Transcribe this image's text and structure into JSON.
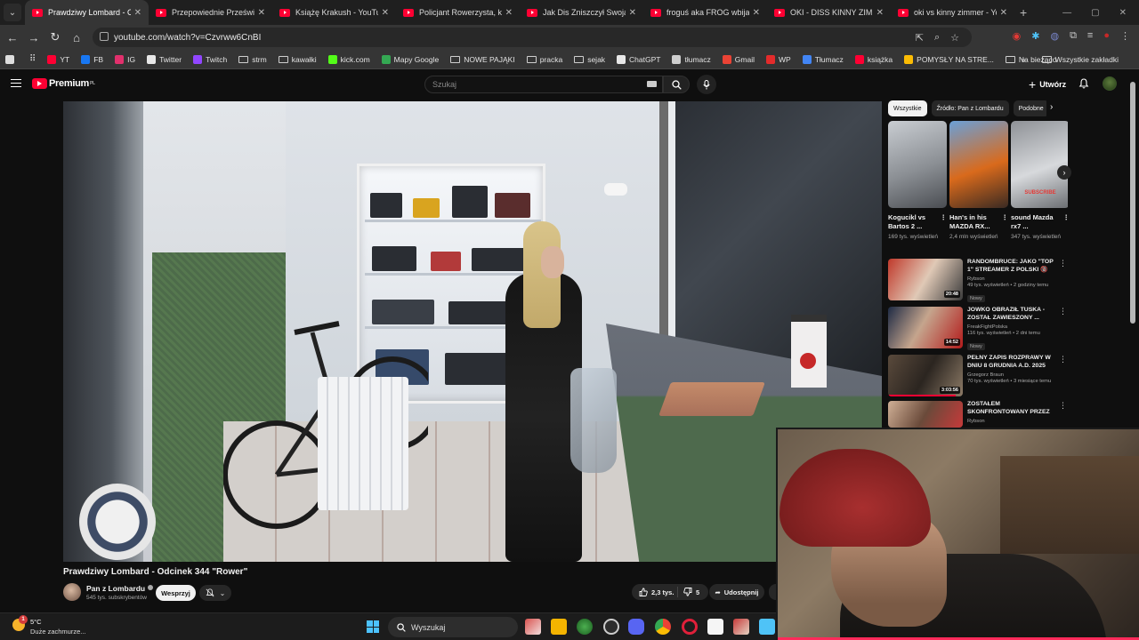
{
  "browser": {
    "tabs": [
      {
        "title": "Prawdziwy Lombard - Od",
        "active": true
      },
      {
        "title": "Przepowiednie Prześwira",
        "active": false
      },
      {
        "title": "Książę Krakush - YouTube",
        "active": false
      },
      {
        "title": "Policjant Rowerzysta, któr",
        "active": false
      },
      {
        "title": "Jak Dis Zniszczył Swoją Ka",
        "active": false
      },
      {
        "title": "froguś aka FROG wbija się",
        "active": false
      },
      {
        "title": "OKI - DISS KINNY ZIMME",
        "active": false
      },
      {
        "title": "oki vs kinny zimmer - You",
        "active": false
      }
    ],
    "url": "youtube.com/watch?v=Czvrww6CnBI",
    "bookmarks": [
      {
        "label": "YT",
        "icon": "youtube-icon",
        "color": "#ff0033"
      },
      {
        "label": "FB",
        "icon": "facebook-icon",
        "color": "#1877f2"
      },
      {
        "label": "IG",
        "icon": "instagram-icon",
        "color": "#e1306c"
      },
      {
        "label": "Twitter",
        "icon": "x-icon",
        "color": "#e8e8e8"
      },
      {
        "label": "Twitch",
        "icon": "twitch-icon",
        "color": "#9146ff"
      },
      {
        "label": "strm",
        "icon": "folder-icon",
        "color": ""
      },
      {
        "label": "kawałki",
        "icon": "folder-icon",
        "color": ""
      },
      {
        "label": "kick.com",
        "icon": "kick-icon",
        "color": "#53fc18"
      },
      {
        "label": "Mapy Google",
        "icon": "maps-icon",
        "color": "#34a853"
      },
      {
        "label": "NOWE PAJĄKI",
        "icon": "folder-icon",
        "color": ""
      },
      {
        "label": "pracka",
        "icon": "folder-icon",
        "color": ""
      },
      {
        "label": "sejak",
        "icon": "folder-icon",
        "color": ""
      },
      {
        "label": "ChatGPT",
        "icon": "chatgpt-icon",
        "color": "#e8e8e8"
      },
      {
        "label": "tłumacz",
        "icon": "translate-icon",
        "color": "#cfcfcf"
      },
      {
        "label": "Gmail",
        "icon": "gmail-icon",
        "color": "#ea4335"
      },
      {
        "label": "WP",
        "icon": "wp-icon",
        "color": "#e32b2b"
      },
      {
        "label": "Tłumacz",
        "icon": "translate-icon",
        "color": "#4285f4"
      },
      {
        "label": "książka",
        "icon": "book-icon",
        "color": "#ff0033"
      },
      {
        "label": "POMYSŁY NA STRE...",
        "icon": "ideas-icon",
        "color": "#fbbc04"
      },
      {
        "label": "Na bieżąco",
        "icon": "folder-icon",
        "color": ""
      }
    ],
    "all_bookmarks": "Wszystkie zakładki"
  },
  "youtube": {
    "logo": "Premium",
    "logo_region": "PL",
    "search_placeholder": "Szukaj",
    "create_label": "Utwórz"
  },
  "video": {
    "title": "Prawdziwy Lombard - Odcinek 344 \"Rower\"",
    "channel": "Pan z Lombardu",
    "subscribers": "545 tys. subskrybentów",
    "support_label": "Wesprzyj",
    "likes": "2,3 tys.",
    "dislikes": "5",
    "share_label": "Udostępnij"
  },
  "sidebar": {
    "chips": [
      "Wszystkie",
      "Źródło: Pan z Lombardu",
      "Podobne"
    ],
    "shorts": [
      {
        "title": "Kogucikl vs Bartos 2 ...",
        "views": "169 tys. wyświetleń",
        "thumb": "linear-gradient(160deg,#c9cdd2,#8b8f94 55%,#4a4d52)"
      },
      {
        "title": "Han's in his MAZDA RX...",
        "views": "2,4 mln wyświetleń",
        "thumb": "linear-gradient(160deg,#6aa0d8,#d96a1c 55%,#3a2a22)"
      },
      {
        "title": "sound Mazda rx7 ...",
        "views": "347 tys. wyświetleń",
        "thumb": "linear-gradient(160deg,#8e9196,#d7d9dc 55%,#6b6e72)"
      }
    ],
    "shorts_badge": "SUBSCRIBE",
    "recommended": [
      {
        "title": "RANDOMBRUCE: JAKO \"TOP 1\" STREAMER Z POLSKI 🔞 *LOL...",
        "channel": "Rybson",
        "meta": "49 tys. wyświetleń • 2 godziny temu",
        "badge": "Nowy",
        "duration": "20:48",
        "thumb": "linear-gradient(120deg,#c0392b,#e0c9b6 50%,#3b3b3b)",
        "progress": 0
      },
      {
        "title": "JÓWKO OBRAŻIŁ TUSKA - ZOSTAŁ ZAWIESZONY ...",
        "channel": "FreakFightPolska",
        "meta": "116 tys. wyświetleń • 2 dni temu",
        "badge": "Nowy",
        "duration": "14:52",
        "thumb": "linear-gradient(120deg,#1d2a44,#c5a58d 45%,#b31b1b)",
        "progress": 0
      },
      {
        "title": "PEŁNY ZAPIS ROZPRAWY W DNIU 8 GRUDNIA A.D. 2025",
        "channel": "Grzegorz Braun",
        "meta": "70 tys. wyświetleń • 3 miesiące temu",
        "badge": "",
        "duration": "3:03:56",
        "thumb": "linear-gradient(120deg,#5a4a3c,#2b2520 50%,#8c7a66)",
        "progress": 0.9
      },
      {
        "title": "ZOSTAŁEM SKONFRONTOWANY PRZEZ ...",
        "channel": "Rybson",
        "meta": "",
        "badge": "",
        "duration": "",
        "thumb": "linear-gradient(120deg,#d0b096,#6a4a3a 50%,#c63a3a)",
        "progress": 0
      }
    ]
  },
  "taskbar": {
    "temp": "5°C",
    "weather": "Duże zachmurze...",
    "weather_badge": "1",
    "search": "Wyszukaj"
  }
}
